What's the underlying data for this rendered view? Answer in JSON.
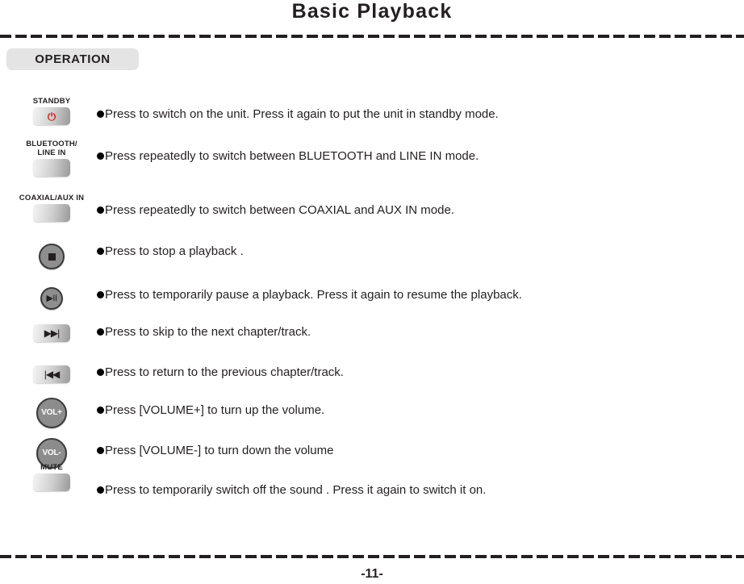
{
  "header": {
    "title": "Basic Playback",
    "section_badge": "OPERATION"
  },
  "footer": {
    "page_number": "-11-"
  },
  "colors": {
    "text": "#231f20",
    "badge_background": "#e4e4e4",
    "power_icon": "#d81f26",
    "circle_key": "#8c8c8c",
    "circle_key_border": "#3a3a3a"
  },
  "rows": [
    {
      "key_label": "STANDBY",
      "key_type": "rect",
      "key_glyph": "⏻",
      "description": "Press to switch on the unit. Press it again to put the unit in standby mode."
    },
    {
      "key_label": "BLUETOOTH/\nLINE IN",
      "key_type": "rect",
      "key_glyph": "",
      "description": "Press repeatedly to switch between BLUETOOTH and LINE IN mode."
    },
    {
      "key_label": "COAXIAL/AUX IN",
      "key_type": "rect",
      "key_glyph": "",
      "description": "Press repeatedly to switch between COAXIAL and AUX IN mode."
    },
    {
      "key_label": "",
      "key_type": "circle-stop",
      "key_glyph": "■",
      "description": "Press to stop a playback ."
    },
    {
      "key_label": "",
      "key_type": "circle-playpause",
      "key_glyph": "▶II",
      "description": "Press to temporarily pause a playback. Press it again to resume the playback."
    },
    {
      "key_label": "",
      "key_type": "rect",
      "key_glyph": "▶▶|",
      "description": "Press to skip to the next chapter/track."
    },
    {
      "key_label": "",
      "key_type": "rect",
      "key_glyph": "|◀◀",
      "description": "Press to return to the previous chapter/track."
    },
    {
      "key_label": "",
      "key_type": "circle-vol",
      "key_glyph": "VOL+",
      "description": "Press [VOLUME+] to turn up the volume."
    },
    {
      "key_label": "",
      "key_type": "circle-vol",
      "key_glyph": "VOL-",
      "description": "Press [VOLUME-] to turn down the volume"
    },
    {
      "key_label": "MUTE",
      "key_type": "rect",
      "key_glyph": "",
      "description": "Press to temporarily switch off the sound . Press it again to switch it on."
    }
  ]
}
